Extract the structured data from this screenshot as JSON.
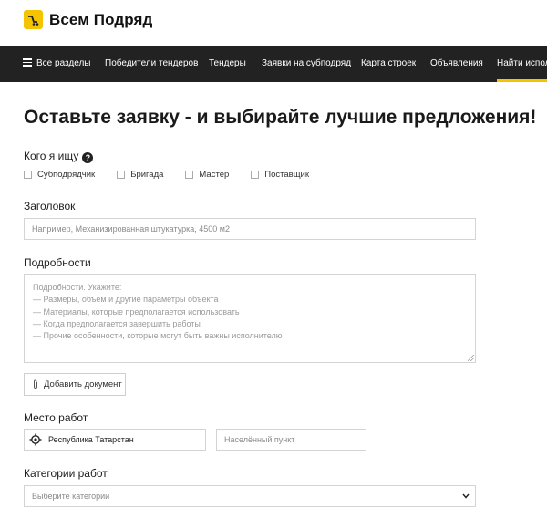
{
  "header": {
    "logo_text": "Всем Подряд"
  },
  "nav": {
    "all_sections": "Все разделы",
    "items": [
      "Победители тендеров",
      "Тендеры",
      "Заявки на субподряд",
      "Карта строек",
      "Объявления",
      "Найти испол"
    ]
  },
  "page": {
    "title": "Оставьте заявку - и выбирайте лучшие предложения!"
  },
  "who": {
    "label": "Кого я ищу",
    "options": [
      "Субподрядчик",
      "Бригада",
      "Мастер",
      "Поставщик"
    ]
  },
  "heading_field": {
    "label": "Заголовок",
    "placeholder": "Например, Механизированная штукатурка, 4500 м2"
  },
  "details": {
    "label": "Подробности",
    "lines": [
      "Подробности. Укажите:",
      "— Размеры, объем и другие параметры объекта",
      "— Материалы, которые предполагается использовать",
      "— Когда предполагается завершить работы",
      "— Прочие особенности, которые могут быть важны исполнителю"
    ]
  },
  "add_document": "Добавить документ",
  "location": {
    "label": "Место работ",
    "region": "Республика Татарстан",
    "locality_placeholder": "Населённый пункт"
  },
  "categories": {
    "label": "Категории работ",
    "placeholder": "Выберите категории"
  },
  "colors": {
    "accent": "#f5c400",
    "nav_bg": "#222222"
  },
  "icons": {
    "logo": "logo-icon",
    "menu": "burger-menu-icon",
    "help": "question-icon",
    "attach": "paperclip-icon",
    "location": "target-location-icon",
    "dropdown": "chevron-down-icon"
  }
}
